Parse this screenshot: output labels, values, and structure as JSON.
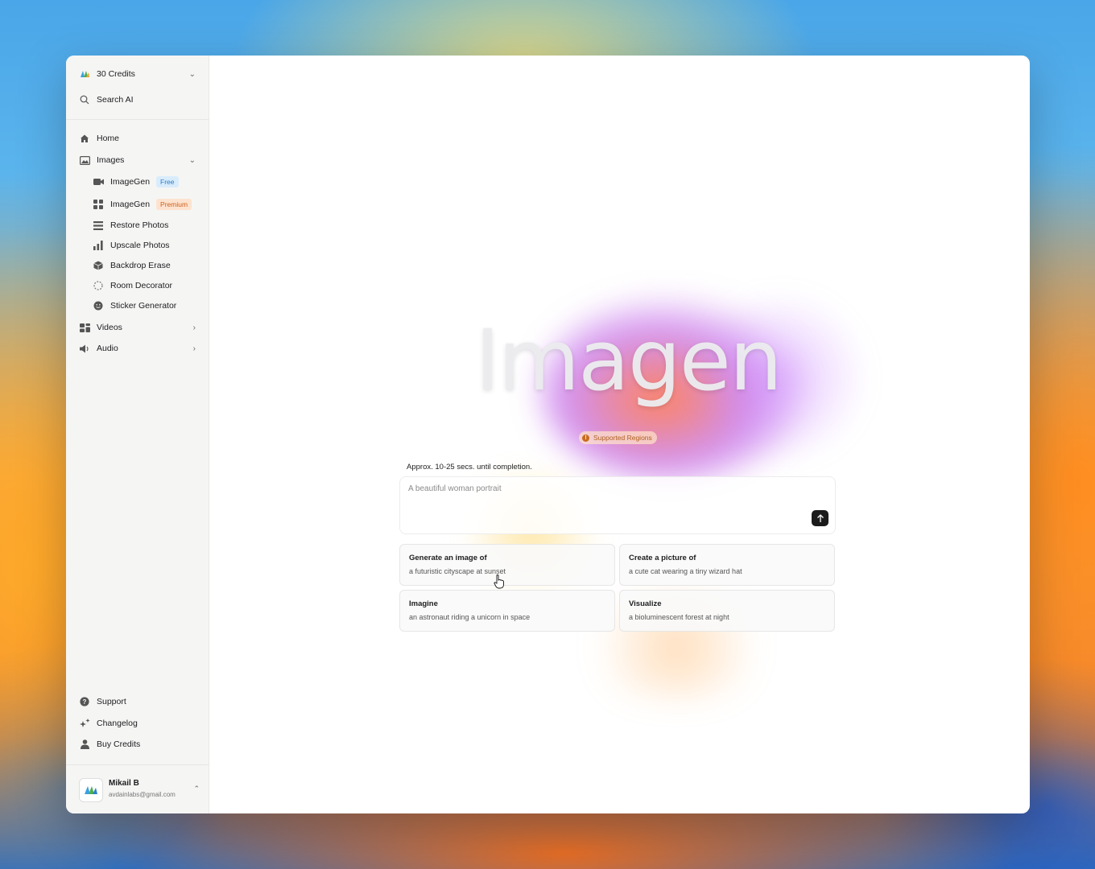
{
  "sidebar": {
    "credits": {
      "label": "30 Credits"
    },
    "search": {
      "label": "Search AI"
    },
    "nav": {
      "home": "Home",
      "images": "Images",
      "videos": "Videos",
      "audio": "Audio"
    },
    "image_items": [
      {
        "label": "ImageGen",
        "badge": "Free",
        "icon": "video-icon"
      },
      {
        "label": "ImageGen",
        "badge": "Premium",
        "icon": "grid-icon"
      },
      {
        "label": "Restore Photos",
        "icon": "list-icon"
      },
      {
        "label": "Upscale Photos",
        "icon": "bar-chart-icon"
      },
      {
        "label": "Backdrop Erase",
        "icon": "cube-icon"
      },
      {
        "label": "Room Decorator",
        "icon": "dashed-circle-icon"
      },
      {
        "label": "Sticker Generator",
        "icon": "smiley-icon"
      }
    ],
    "footer": {
      "support": "Support",
      "changelog": "Changelog",
      "buy_credits": "Buy Credits"
    },
    "user": {
      "name": "Mikail B",
      "email": "avdainlabs@gmail.com"
    }
  },
  "main": {
    "logo": "Imagen",
    "supported_regions": "Supported Regions",
    "approx": "Approx. 10-25 secs. until completion.",
    "prompt_placeholder": "A beautiful woman portrait",
    "suggestions": [
      {
        "title": "Generate an image of",
        "subtitle": "a futuristic cityscape at sunset"
      },
      {
        "title": "Create a picture of",
        "subtitle": "a cute cat wearing a tiny wizard hat"
      },
      {
        "title": "Imagine",
        "subtitle": "an astronaut riding a unicorn in space"
      },
      {
        "title": "Visualize",
        "subtitle": "a bioluminescent forest at night"
      }
    ]
  },
  "colors": {
    "free_badge": "#2d7ec4",
    "premium_badge": "#cf5f1b",
    "send_button": "#1b1b1b"
  }
}
